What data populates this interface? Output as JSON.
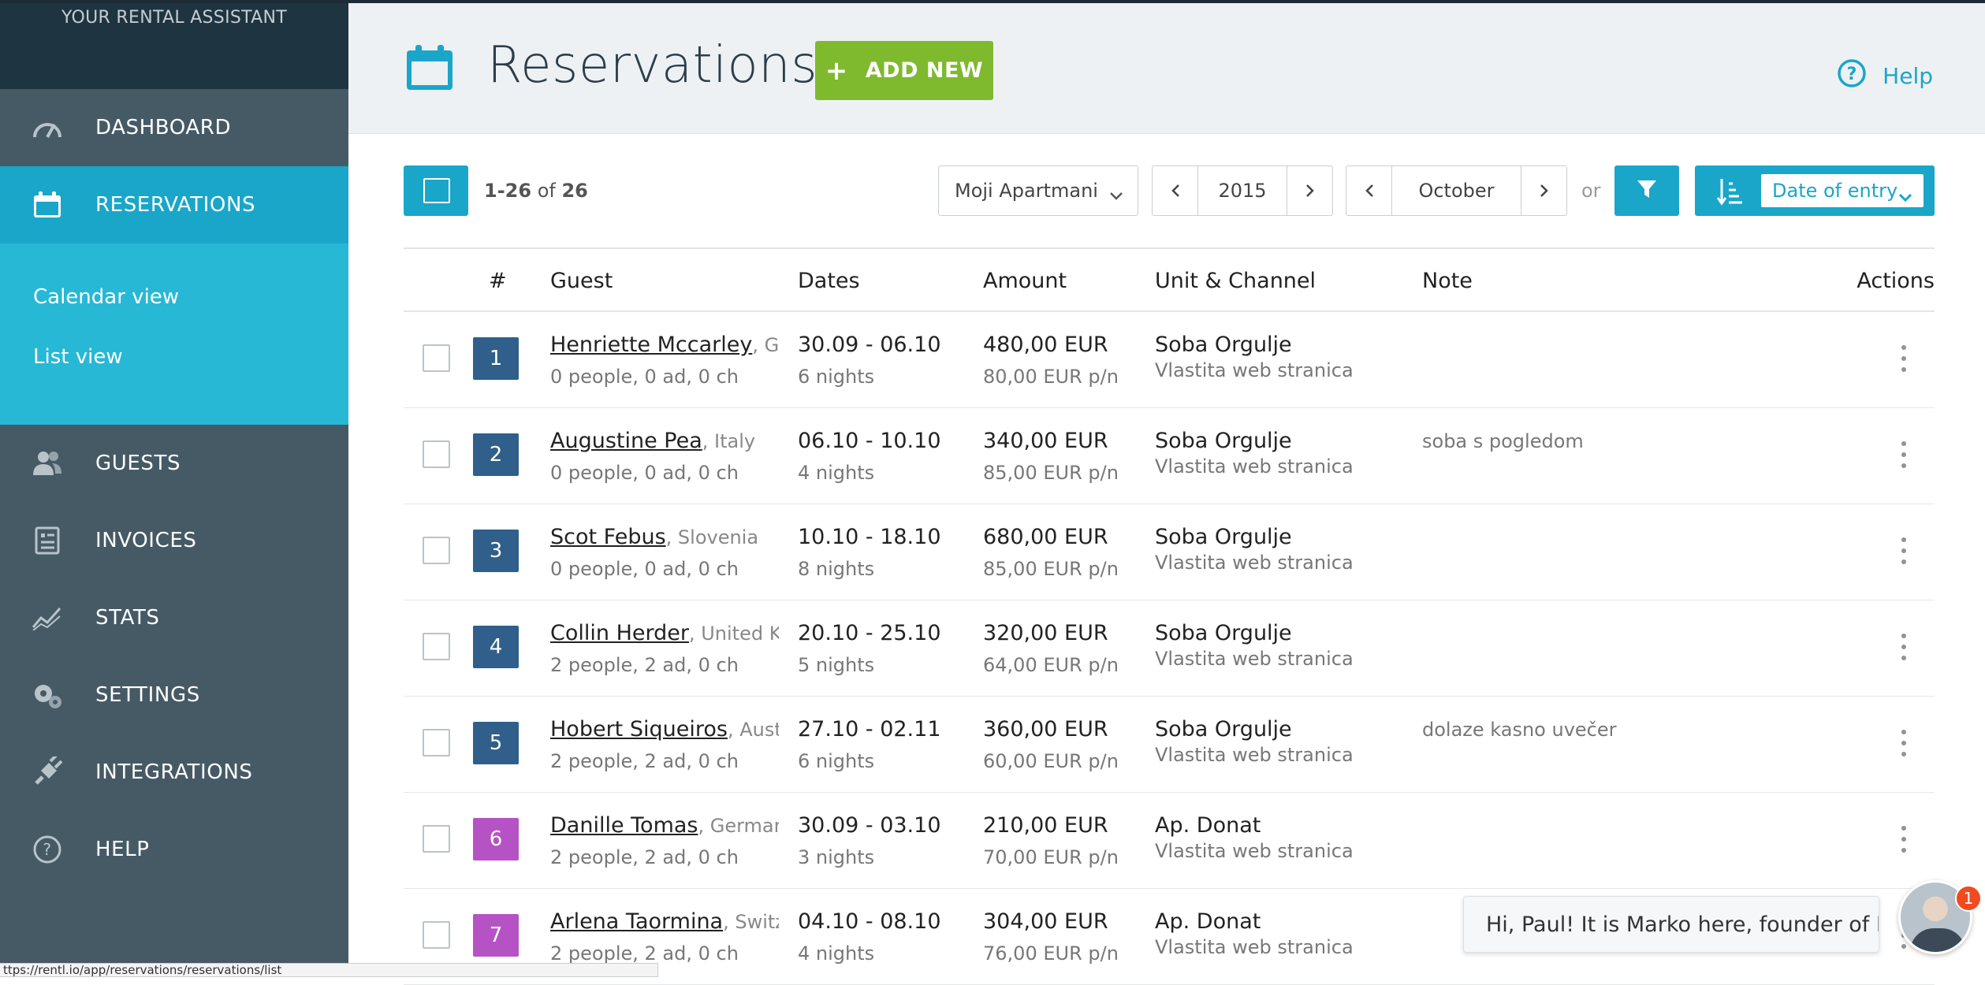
{
  "sidebar": {
    "brand": "YOUR RENTAL ASSISTANT",
    "items": [
      {
        "label": "DASHBOARD",
        "icon": "speedometer-icon"
      },
      {
        "label": "RESERVATIONS",
        "icon": "calendar-icon",
        "active": true
      },
      {
        "label": "GUESTS",
        "icon": "users-icon"
      },
      {
        "label": "INVOICES",
        "icon": "invoice-icon"
      },
      {
        "label": "STATS",
        "icon": "chart-line-icon"
      },
      {
        "label": "SETTINGS",
        "icon": "gears-icon"
      },
      {
        "label": "INTEGRATIONS",
        "icon": "plug-icon"
      },
      {
        "label": "HELP",
        "icon": "question-icon"
      }
    ],
    "subitems": [
      "Calendar view",
      "List view"
    ]
  },
  "header": {
    "title": "Reservations",
    "add_label": "ADD NEW",
    "help_label": "Help"
  },
  "toolbar": {
    "range": "1-26",
    "of": "of",
    "total": "26",
    "property": "Moji Apartmani",
    "year": "2015",
    "month": "October",
    "or": "or",
    "sort": "Date of entry"
  },
  "table": {
    "columns": [
      "#",
      "Guest",
      "Dates",
      "Amount",
      "Unit & Channel",
      "Note",
      "Actions"
    ],
    "rows": [
      {
        "num": "1",
        "color": "#2f5f8a",
        "name": "Henriette Mccarley",
        "country": ", Ge",
        "people": "0 people, 0 ad, 0 ch",
        "dates": "30.09 - 06.10",
        "nights": "6 nights",
        "amount": "480,00 EUR",
        "pn": "80,00 EUR p/n",
        "unit": "Soba Orgulje",
        "channel": "Vlastita web stranica",
        "note": ""
      },
      {
        "num": "2",
        "color": "#2f5f8a",
        "name": "Augustine Pea",
        "country": ", Italy",
        "people": "0 people, 0 ad, 0 ch",
        "dates": "06.10 - 10.10",
        "nights": "4 nights",
        "amount": "340,00 EUR",
        "pn": "85,00 EUR p/n",
        "unit": "Soba Orgulje",
        "channel": "Vlastita web stranica",
        "note": "soba s pogledom"
      },
      {
        "num": "3",
        "color": "#2f5f8a",
        "name": "Scot Febus",
        "country": ", Slovenia",
        "people": "0 people, 0 ad, 0 ch",
        "dates": "10.10 - 18.10",
        "nights": "8 nights",
        "amount": "680,00 EUR",
        "pn": "85,00 EUR p/n",
        "unit": "Soba Orgulje",
        "channel": "Vlastita web stranica",
        "note": ""
      },
      {
        "num": "4",
        "color": "#2f5f8a",
        "name": "Collin Herder",
        "country": ", United Ki",
        "people": "2 people, 2 ad, 0 ch",
        "dates": "20.10 - 25.10",
        "nights": "5 nights",
        "amount": "320,00 EUR",
        "pn": "64,00 EUR p/n",
        "unit": "Soba Orgulje",
        "channel": "Vlastita web stranica",
        "note": ""
      },
      {
        "num": "5",
        "color": "#2f5f8a",
        "name": "Hobert Siqueiros",
        "country": ", Austr",
        "people": "2 people, 2 ad, 0 ch",
        "dates": "27.10 - 02.11",
        "nights": "6 nights",
        "amount": "360,00 EUR",
        "pn": "60,00 EUR p/n",
        "unit": "Soba Orgulje",
        "channel": "Vlastita web stranica",
        "note": "dolaze kasno uvečer"
      },
      {
        "num": "6",
        "color": "#b653c4",
        "name": "Danille Tomas",
        "country": ", German",
        "people": "2 people, 2 ad, 0 ch",
        "dates": "30.09 - 03.10",
        "nights": "3 nights",
        "amount": "210,00 EUR",
        "pn": "70,00 EUR p/n",
        "unit": "Ap. Donat",
        "channel": "Vlastita web stranica",
        "note": ""
      },
      {
        "num": "7",
        "color": "#b653c4",
        "name": "Arlena Taormina",
        "country": ", Switz",
        "people": "2 people, 2 ad, 0 ch",
        "dates": "04.10 - 08.10",
        "nights": "4 nights",
        "amount": "304,00 EUR",
        "pn": "76,00 EUR p/n",
        "unit": "Ap. Donat",
        "channel": "Vlastita web stranica",
        "note": ""
      }
    ]
  },
  "chat": {
    "message": "Hi, Paul! It is Marko here, founder of R...",
    "badge": "1"
  },
  "status_url": "ttps://rentl.io/app/reservations/reservations/list"
}
